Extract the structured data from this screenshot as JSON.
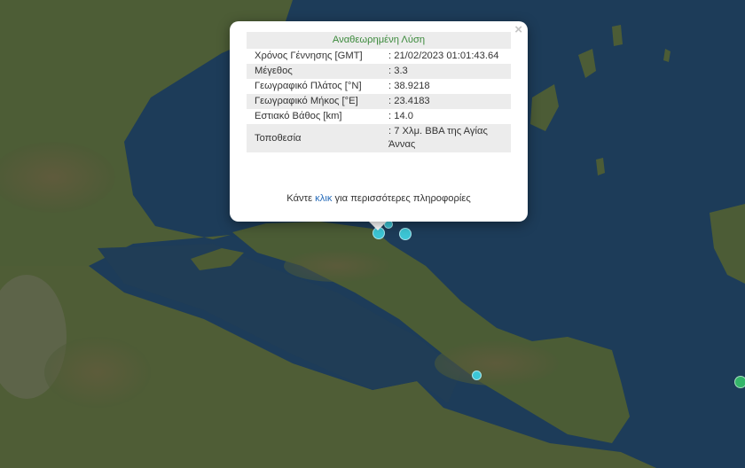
{
  "popup": {
    "title": "Αναθεωρημένη Λύση",
    "close_symbol": "×",
    "rows": [
      {
        "label": "Χρόνος Γέννησης [GMT]",
        "value": ": 21/02/2023 01:01:43.64"
      },
      {
        "label": "Μέγεθος",
        "value": ": 3.3"
      },
      {
        "label": "Γεωγραφικό Πλάτος [°N]",
        "value": ": 38.9218"
      },
      {
        "label": "Γεωγραφικό Μήκος [°E]",
        "value": ": 23.4183"
      },
      {
        "label": "Εστιακό Βάθος [km]",
        "value": ": 14.0"
      },
      {
        "label": "Τοποθεσία",
        "value": ": 7 Χλμ. ΒΒΑ της Αγίας Άννας"
      }
    ],
    "more_prefix": "Κάντε ",
    "more_link": "κλικ",
    "more_suffix": " για περισσότερες πληροφορίες"
  },
  "colors": {
    "sea": "#1d3c59",
    "land": "#4a5a34",
    "quake_cyan": "#3cc6d6",
    "quake_green": "#34b56a",
    "title_green": "#3c8a3c",
    "link_blue": "#2a6ebb"
  }
}
